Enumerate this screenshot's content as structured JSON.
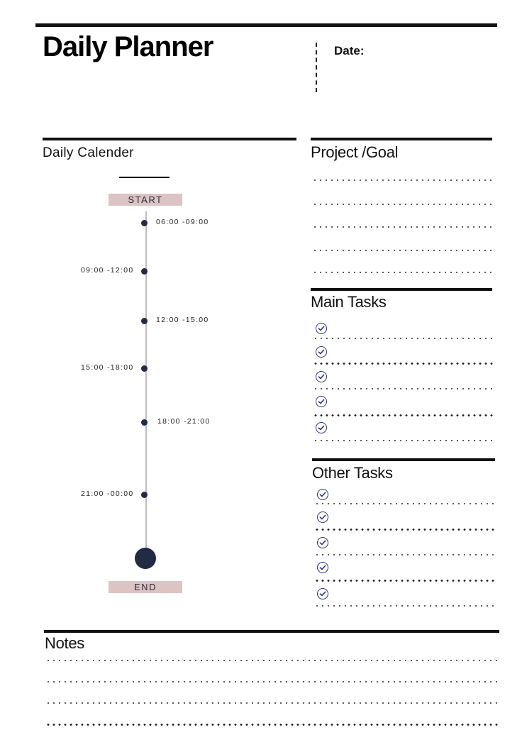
{
  "header": {
    "title": "Daily Planner",
    "date_label": "Date:"
  },
  "calendar": {
    "title": "Daily Calender",
    "start_label": "START",
    "end_label": "END",
    "slots": [
      {
        "label": "06:00 -09:00",
        "side": "right"
      },
      {
        "label": "09:00 -12:00",
        "side": "left"
      },
      {
        "label": "12:00 -15:00",
        "side": "right"
      },
      {
        "label": "15:00 -18:00",
        "side": "left"
      },
      {
        "label": "18:00 -21:00",
        "side": "right"
      },
      {
        "label": "21:00 -00:00",
        "side": "left"
      }
    ]
  },
  "project_goal": {
    "title": "Project /Goal",
    "line_count": 5
  },
  "main_tasks": {
    "title": "Main Tasks",
    "items": [
      "",
      "",
      "",
      "",
      ""
    ],
    "icon": "check-circle-icon"
  },
  "other_tasks": {
    "title": "Other Tasks",
    "items": [
      "",
      "",
      "",
      "",
      ""
    ],
    "icon": "check-circle-icon"
  },
  "notes": {
    "title": "Notes",
    "line_count": 4
  },
  "colors": {
    "accent_navy": "#232a44",
    "check_blue": "#2d3475",
    "pill_pink": "#dcc3c4",
    "rule_black": "#111111"
  }
}
